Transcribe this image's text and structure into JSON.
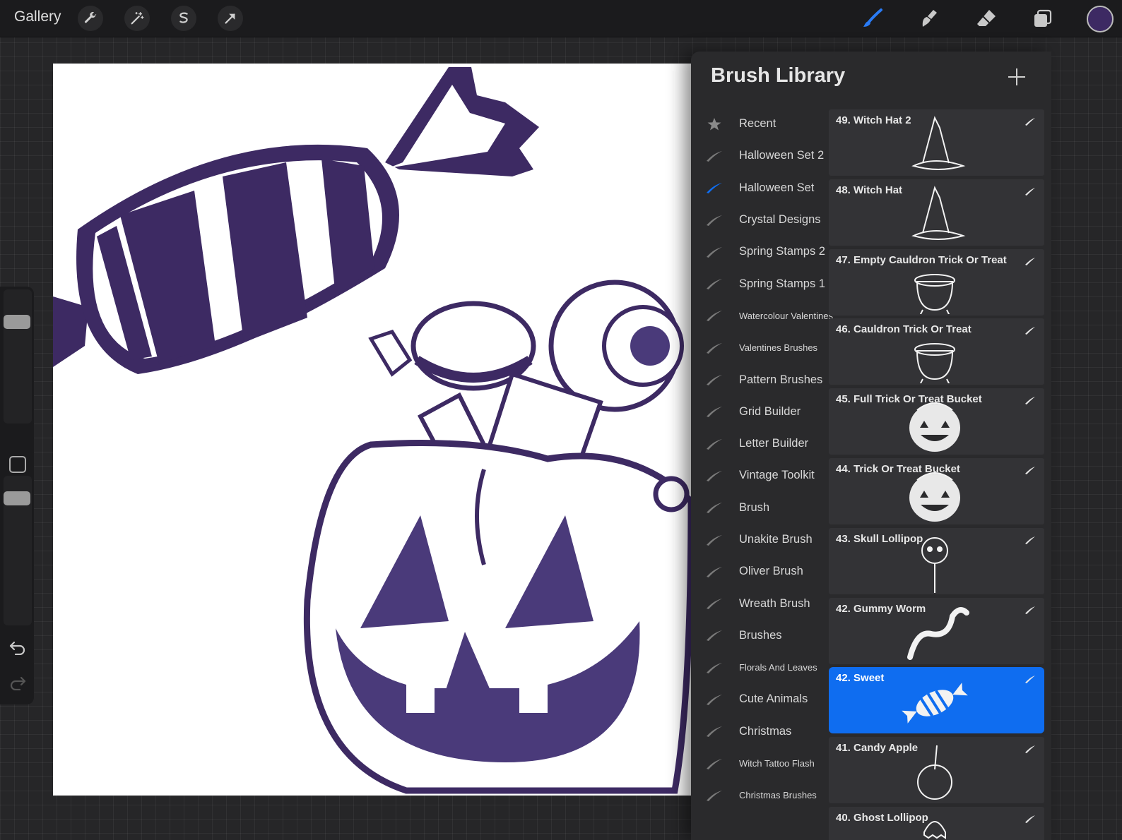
{
  "app": {
    "gallery_label": "Gallery",
    "top_tools": [
      "wrench-icon",
      "magic-wand-icon",
      "selection-icon",
      "transform-arrow-icon"
    ],
    "right_tools": [
      "brush-icon",
      "smudge-icon",
      "eraser-icon",
      "layers-icon"
    ],
    "current_color": "#3d2a63",
    "accent_color": "#0f6df0"
  },
  "canvas": {
    "ink_color": "#4a3a7a",
    "paper_color": "#ffffff"
  },
  "library": {
    "title": "Brush Library",
    "sets": [
      {
        "label": "Recent",
        "icon": "star-icon",
        "active": false,
        "small": false
      },
      {
        "label": "Halloween Set 2",
        "icon": "stroke-icon",
        "active": false,
        "small": false
      },
      {
        "label": "Halloween Set",
        "icon": "stroke-icon",
        "active": true,
        "small": false
      },
      {
        "label": "Crystal Designs",
        "icon": "stroke-icon",
        "active": false,
        "small": false
      },
      {
        "label": "Spring Stamps 2",
        "icon": "stroke-icon",
        "active": false,
        "small": false
      },
      {
        "label": "Spring Stamps 1",
        "icon": "stroke-icon",
        "active": false,
        "small": false
      },
      {
        "label": "Watercolour Valentines",
        "icon": "stroke-icon",
        "active": false,
        "small": true
      },
      {
        "label": "Valentines Brushes",
        "icon": "stroke-icon",
        "active": false,
        "small": true
      },
      {
        "label": "Pattern Brushes",
        "icon": "stroke-icon",
        "active": false,
        "small": false
      },
      {
        "label": "Grid Builder",
        "icon": "stroke-icon",
        "active": false,
        "small": false
      },
      {
        "label": "Letter Builder",
        "icon": "stroke-icon",
        "active": false,
        "small": false
      },
      {
        "label": "Vintage Toolkit",
        "icon": "stroke-icon",
        "active": false,
        "small": false
      },
      {
        "label": "Brush",
        "icon": "stroke-icon",
        "active": false,
        "small": false
      },
      {
        "label": "Unakite Brush",
        "icon": "stroke-icon",
        "active": false,
        "small": false
      },
      {
        "label": "Oliver Brush",
        "icon": "stroke-icon",
        "active": false,
        "small": false
      },
      {
        "label": "Wreath Brush",
        "icon": "stroke-icon",
        "active": false,
        "small": false
      },
      {
        "label": "Brushes",
        "icon": "stroke-icon",
        "active": false,
        "small": false
      },
      {
        "label": "Florals And Leaves",
        "icon": "stroke-icon",
        "active": false,
        "small": true
      },
      {
        "label": "Cute Animals",
        "icon": "stroke-icon",
        "active": false,
        "small": false
      },
      {
        "label": "Christmas",
        "icon": "stroke-icon",
        "active": false,
        "small": false
      },
      {
        "label": "Witch Tattoo Flash",
        "icon": "stroke-icon",
        "active": false,
        "small": true
      },
      {
        "label": "Christmas Brushes",
        "icon": "stroke-icon",
        "active": false,
        "small": true
      }
    ],
    "brushes": [
      {
        "name": "49. Witch Hat 2",
        "preview": "witch-hat-icon",
        "selected": false
      },
      {
        "name": "48. Witch Hat",
        "preview": "witch-hat-icon",
        "selected": false
      },
      {
        "name": "47. Empty Cauldron Trick Or Treat",
        "preview": "cauldron-icon",
        "selected": false
      },
      {
        "name": "46. Cauldron Trick Or Treat",
        "preview": "cauldron-icon",
        "selected": false
      },
      {
        "name": "45. Full Trick Or Treat Bucket",
        "preview": "pumpkin-bucket-icon",
        "selected": false
      },
      {
        "name": "44. Trick Or Treat Bucket",
        "preview": "pumpkin-bucket-icon",
        "selected": false
      },
      {
        "name": "43. Skull Lollipop",
        "preview": "skull-lollipop-icon",
        "selected": false
      },
      {
        "name": "42. Gummy Worm",
        "preview": "gummy-worm-icon",
        "selected": false
      },
      {
        "name": "42. Sweet",
        "preview": "sweet-icon",
        "selected": true
      },
      {
        "name": "41. Candy Apple",
        "preview": "candy-apple-icon",
        "selected": false
      },
      {
        "name": "40. Ghost Lollipop",
        "preview": "ghost-lollipop-icon",
        "selected": false
      }
    ]
  }
}
